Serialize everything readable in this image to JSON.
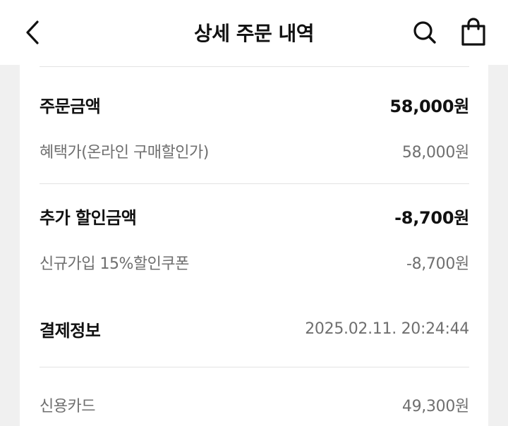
{
  "header": {
    "title": "상세 주문 내역",
    "icons": [
      "back-arrow-icon",
      "search-icon",
      "shopping-bag-icon"
    ]
  },
  "order_amount": {
    "label": "주문금액",
    "value": "58,000원",
    "detail_label": "혜택가(온라인 구매할인가)",
    "detail_value": "58,000원"
  },
  "extra_discount": {
    "label": "추가 할인금액",
    "value": "-8,700원",
    "detail_label": "신규가입 15%할인쿠폰",
    "detail_value": "-8,700원"
  },
  "payment_info": {
    "label": "결제정보",
    "datetime": "2025.02.11. 20:24:44",
    "method_label": "신용카드",
    "method_value": "49,300원"
  },
  "colors": {
    "primary_text": "#111111",
    "secondary_text": "#6f6f6f",
    "divider": "#e3e3e3",
    "background": "#f0f0f0"
  }
}
